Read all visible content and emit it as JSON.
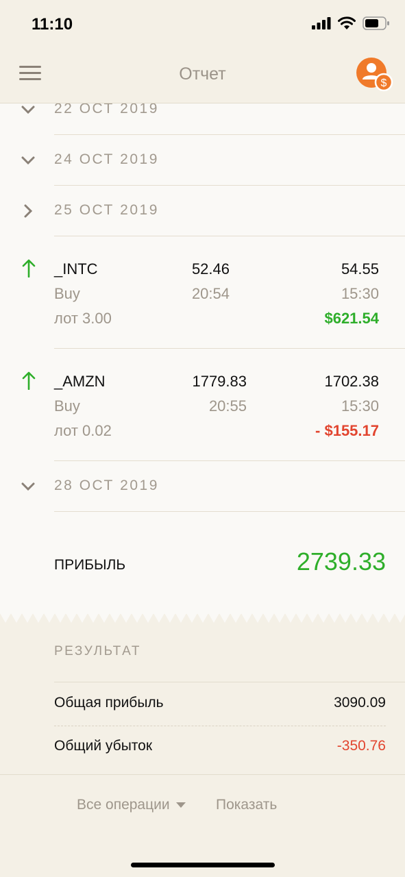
{
  "status_bar": {
    "time": "11:10"
  },
  "header": {
    "title": "Отчет"
  },
  "dates": {
    "d1": "22 ОСТ 2019",
    "d2": "24 ОСТ 2019",
    "d3": "25 ОСТ 2019",
    "d4": "28 ОСТ 2019"
  },
  "trades": [
    {
      "symbol": "_INTC",
      "direction": "Buy",
      "lot": "лот 3.00",
      "open_price": "52.46",
      "open_time": "20:54",
      "close_price": "54.55",
      "close_time": "15:30",
      "pnl": "$621.54",
      "pnl_status": "positive",
      "arrow_icon": "arrow-up-icon"
    },
    {
      "symbol": "_AMZN",
      "direction": "Buy",
      "lot": "лот 0.02",
      "open_price": "1779.83",
      "open_time": "20:55",
      "close_price": "1702.38",
      "close_time": "15:30",
      "pnl": "- $155.17",
      "pnl_status": "negative",
      "arrow_icon": "arrow-up-icon"
    }
  ],
  "profit": {
    "label": "ПРИБЫЛЬ",
    "value": "2739.33"
  },
  "result": {
    "title": "РЕЗУЛЬТАТ",
    "total_profit_label": "Общая прибыль",
    "total_profit_value": "3090.09",
    "total_loss_label": "Общий убыток",
    "total_loss_value": "-350.76"
  },
  "footer": {
    "filter_label": "Все операции",
    "show_label": "Показать"
  },
  "colors": {
    "background": "#f4f0e6",
    "card": "#faf9f6",
    "accent_orange": "#f07a2a",
    "positive": "#2eae2a",
    "negative": "#e2452f",
    "muted": "#9e968b"
  }
}
